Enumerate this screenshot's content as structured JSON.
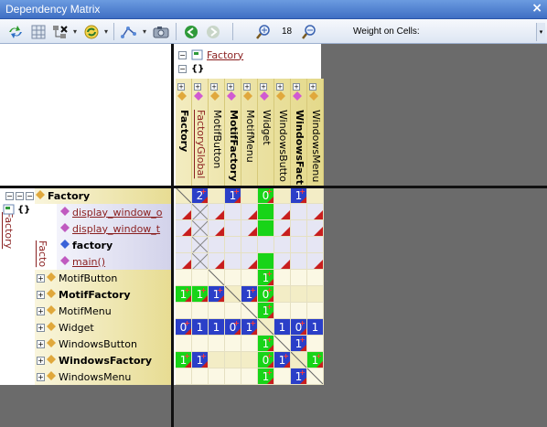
{
  "window": {
    "title": "Dependency Matrix",
    "close_glyph": "×"
  },
  "toolbar": {
    "zoom_value": "18",
    "weight_label": "Weight on Cells:",
    "dropdown_glyph": "▾"
  },
  "columns": {
    "group_label": "Factory",
    "namespace_label": "{}",
    "items": [
      {
        "label": "Factory",
        "style": "b"
      },
      {
        "label": "FactoryGlobal",
        "style": "ul"
      },
      {
        "label": "MotifButton",
        "style": ""
      },
      {
        "label": "MotifFactory",
        "style": "b"
      },
      {
        "label": "MotifMenu",
        "style": ""
      },
      {
        "label": "Widget",
        "style": ""
      },
      {
        "label": "WindowsButto",
        "style": ""
      },
      {
        "label": "WindowsFact",
        "style": "b"
      },
      {
        "label": "WindowsMenu",
        "style": ""
      }
    ]
  },
  "tree": {
    "group_label": "Factory",
    "namespace_label": "{}",
    "subgroup_label": "Facto",
    "rows": [
      {
        "label": "Factory",
        "kind": "top"
      },
      {
        "label": "display_window_o",
        "kind": "fn"
      },
      {
        "label": "display_window_t",
        "kind": "fn"
      },
      {
        "label": "factory",
        "kind": "bold"
      },
      {
        "label": "main()",
        "kind": "fn"
      },
      {
        "label": "MotifButton",
        "kind": "plain"
      },
      {
        "label": "MotifFactory",
        "kind": "bold"
      },
      {
        "label": "MotifMenu",
        "kind": "plain"
      },
      {
        "label": "Widget",
        "kind": "plain"
      },
      {
        "label": "WindowsButton",
        "kind": "plain"
      },
      {
        "label": "WindowsFactory",
        "kind": "bold"
      },
      {
        "label": "WindowsMenu",
        "kind": "plain"
      }
    ]
  },
  "colors": {
    "blue": "#2b3fc8",
    "green": "#18d418",
    "red_triangle": "#c81e1e",
    "grey": "#6b6b6b"
  },
  "matrix": [
    [
      "x",
      "B2+",
      "",
      "B1+",
      "",
      "G0+",
      "",
      "B1+",
      ""
    ],
    [
      "t",
      "d",
      "t",
      "",
      "t",
      "G",
      "t",
      "",
      "t"
    ],
    [
      "t",
      "d",
      "t",
      "",
      "t",
      "G",
      "t",
      "",
      "t"
    ],
    [
      "",
      "d",
      "",
      "",
      "",
      "",
      "",
      "",
      ""
    ],
    [
      "t",
      "d",
      "t",
      "",
      "t",
      "G",
      "t",
      "",
      "t"
    ],
    [
      "",
      "",
      "d",
      "",
      "",
      "G1+",
      "",
      "",
      ""
    ],
    [
      "G1+",
      "G1+",
      "B1+",
      "d",
      "B1+",
      "G0+",
      "",
      "",
      ""
    ],
    [
      "",
      "",
      "",
      "",
      "d",
      "G1+",
      "",
      "",
      ""
    ],
    [
      "B0+",
      "B1",
      "B1",
      "B0+",
      "B1+",
      "d",
      "B1",
      "B0+",
      "B1"
    ],
    [
      "",
      "",
      "",
      "",
      "",
      "G1+",
      "d",
      "B1+",
      ""
    ],
    [
      "G1+",
      "B1+",
      "",
      "",
      "",
      "G0+",
      "B1+",
      "d",
      "G1+"
    ],
    [
      "",
      "",
      "",
      "",
      "",
      "G1+",
      "",
      "B1+",
      "d"
    ]
  ]
}
